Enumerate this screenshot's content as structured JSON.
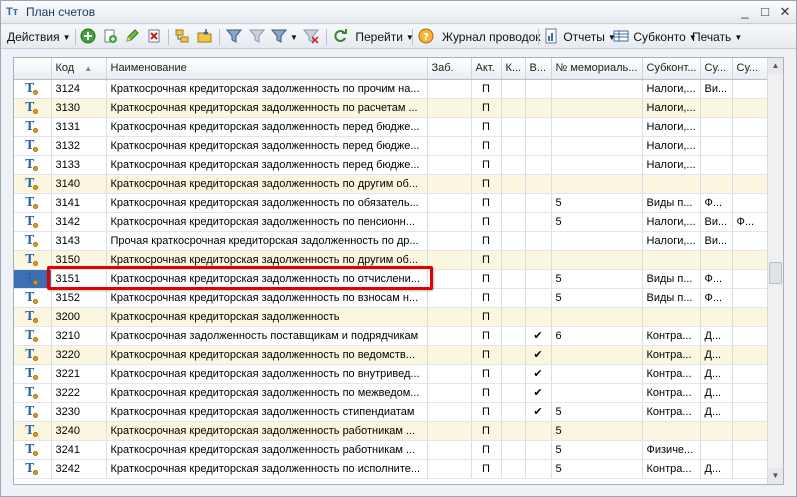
{
  "window": {
    "title": "План счетов",
    "minimize": "_",
    "maximize": "□",
    "close": "✕"
  },
  "toolbar": {
    "actions": "Действия",
    "goto": "Перейти",
    "journal": "Журнал проводок",
    "reports": "Отчеты",
    "subconto": "Субконто",
    "print": "Печать"
  },
  "columns": [
    "",
    "Код",
    "Наименование",
    "Заб.",
    "Акт.",
    "К...",
    "В...",
    "№ мемориаль...",
    "Субконт...",
    "Су...",
    "Су..."
  ],
  "rows": [
    {
      "code": "3124",
      "name": "Краткосрочная кредиторская задолженность по прочим на...",
      "zab": "",
      "akt": "П",
      "k": "",
      "v": "",
      "memo": "",
      "s1": "Налоги,...",
      "s2": "Ви...",
      "s3": "",
      "group": false
    },
    {
      "code": "3130",
      "name": "Краткосрочная кредиторская задолженность по расчетам ...",
      "zab": "",
      "akt": "П",
      "k": "",
      "v": "",
      "memo": "",
      "s1": "Налоги,...",
      "s2": "",
      "s3": "",
      "group": true
    },
    {
      "code": "3131",
      "name": "Краткосрочная кредиторская задолженность перед бюдже...",
      "zab": "",
      "akt": "П",
      "k": "",
      "v": "",
      "memo": "",
      "s1": "Налоги,...",
      "s2": "",
      "s3": "",
      "group": false
    },
    {
      "code": "3132",
      "name": "Краткосрочная кредиторская задолженность перед бюдже...",
      "zab": "",
      "akt": "П",
      "k": "",
      "v": "",
      "memo": "",
      "s1": "Налоги,...",
      "s2": "",
      "s3": "",
      "group": false
    },
    {
      "code": "3133",
      "name": "Краткосрочная кредиторская задолженность перед бюдже...",
      "zab": "",
      "akt": "П",
      "k": "",
      "v": "",
      "memo": "",
      "s1": "Налоги,...",
      "s2": "",
      "s3": "",
      "group": false
    },
    {
      "code": "3140",
      "name": "Краткосрочная кредиторская задолженность по другим об...",
      "zab": "",
      "akt": "П",
      "k": "",
      "v": "",
      "memo": "",
      "s1": "",
      "s2": "",
      "s3": "",
      "group": true
    },
    {
      "code": "3141",
      "name": "Краткосрочная кредиторская задолженность по обязатель...",
      "zab": "",
      "akt": "П",
      "k": "",
      "v": "",
      "memo": "5",
      "s1": "Виды п...",
      "s2": "Ф...",
      "s3": "",
      "group": false
    },
    {
      "code": "3142",
      "name": "Краткосрочная кредиторская задолженность по пенсионн...",
      "zab": "",
      "akt": "П",
      "k": "",
      "v": "",
      "memo": "5",
      "s1": "Налоги,...",
      "s2": "Ви...",
      "s3": "Ф...",
      "group": false
    },
    {
      "code": "3143",
      "name": "Прочая краткосрочная кредиторская задолженность по др...",
      "zab": "",
      "akt": "П",
      "k": "",
      "v": "",
      "memo": "",
      "s1": "Налоги,...",
      "s2": "Ви...",
      "s3": "",
      "group": false
    },
    {
      "code": "3150",
      "name": "Краткосрочная кредиторская задолженность по другим об...",
      "zab": "",
      "akt": "П",
      "k": "",
      "v": "",
      "memo": "",
      "s1": "",
      "s2": "",
      "s3": "",
      "group": true
    },
    {
      "code": "3151",
      "name": "Краткосрочная кредиторская задолженность по отчислени...",
      "zab": "",
      "akt": "П",
      "k": "",
      "v": "",
      "memo": "5",
      "s1": "Виды п...",
      "s2": "Ф...",
      "s3": "",
      "group": false,
      "selected": true
    },
    {
      "code": "3152",
      "name": "Краткосрочная кредиторская задолженность по взносам н...",
      "zab": "",
      "akt": "П",
      "k": "",
      "v": "",
      "memo": "5",
      "s1": "Виды п...",
      "s2": "Ф...",
      "s3": "",
      "group": false
    },
    {
      "code": "3200",
      "name": "Краткосрочная кредиторская задолженность",
      "zab": "",
      "akt": "П",
      "k": "",
      "v": "",
      "memo": "",
      "s1": "",
      "s2": "",
      "s3": "",
      "group": true
    },
    {
      "code": "3210",
      "name": "Краткосрочная задолженность поставщикам и подрядчикам",
      "zab": "",
      "akt": "П",
      "k": "",
      "v": "✔",
      "memo": "6",
      "s1": "Контра...",
      "s2": "Д...",
      "s3": "",
      "group": false
    },
    {
      "code": "3220",
      "name": "Краткосрочная кредиторская задолженность по ведомств...",
      "zab": "",
      "akt": "П",
      "k": "",
      "v": "✔",
      "memo": "",
      "s1": "Контра...",
      "s2": "Д...",
      "s3": "",
      "group": true
    },
    {
      "code": "3221",
      "name": "Краткосрочная кредиторская задолженность по внутривед...",
      "zab": "",
      "akt": "П",
      "k": "",
      "v": "✔",
      "memo": "",
      "s1": "Контра...",
      "s2": "Д...",
      "s3": "",
      "group": false
    },
    {
      "code": "3222",
      "name": "Краткосрочная кредиторская задолженность по межведом...",
      "zab": "",
      "akt": "П",
      "k": "",
      "v": "✔",
      "memo": "",
      "s1": "Контра...",
      "s2": "Д...",
      "s3": "",
      "group": false
    },
    {
      "code": "3230",
      "name": "Краткосрочная кредиторская задолженность стипендиатам",
      "zab": "",
      "akt": "П",
      "k": "",
      "v": "✔",
      "memo": "5",
      "s1": "Контра...",
      "s2": "Д...",
      "s3": "",
      "group": false
    },
    {
      "code": "3240",
      "name": "Краткосрочная кредиторская задолженность работникам ...",
      "zab": "",
      "akt": "П",
      "k": "",
      "v": "",
      "memo": "5",
      "s1": "",
      "s2": "",
      "s3": "",
      "group": true
    },
    {
      "code": "3241",
      "name": "Краткосрочная кредиторская задолженность работникам ...",
      "zab": "",
      "akt": "П",
      "k": "",
      "v": "",
      "memo": "5",
      "s1": "Физиче...",
      "s2": "",
      "s3": "",
      "group": false
    },
    {
      "code": "3242",
      "name": "Краткосрочная кредиторская задолженность по исполните...",
      "zab": "",
      "akt": "П",
      "k": "",
      "v": "",
      "memo": "5",
      "s1": "Контра...",
      "s2": "Д...",
      "s3": "",
      "group": false
    }
  ],
  "colors": {
    "highlight": "#e00000",
    "group_row": "#fbf6df",
    "selection": "#3d6fb3"
  }
}
